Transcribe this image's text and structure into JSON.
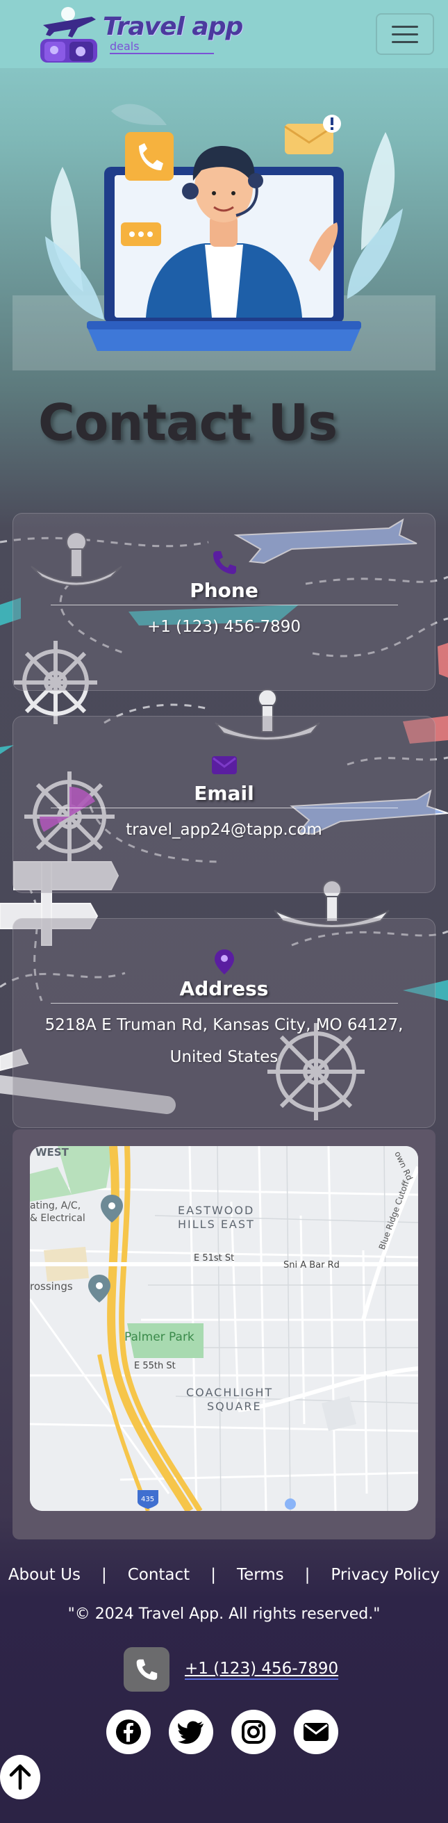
{
  "navbar": {
    "brand_title": "Travel app",
    "brand_sub": "deals",
    "toggler_icon": "hamburger-menu-icon"
  },
  "hero": {
    "title": "Contact Us",
    "illustration": "customer-support-agent-laptop"
  },
  "cards": {
    "phone": {
      "title": "Phone",
      "text": "+1 (123) 456-7890",
      "icon": "phone-icon",
      "icon_color": "#5a1ea0"
    },
    "email": {
      "title": "Email",
      "text": "travel_app24@tapp.com",
      "icon": "envelope-icon",
      "icon_color": "#5a1ea0"
    },
    "address": {
      "title": "Address",
      "text": "5218A E Truman Rd, Kansas City, MO 64127, United States",
      "icon": "map-pin-icon"
    }
  },
  "map": {
    "labels": {
      "west": "WEST",
      "eastwood1": "EASTWOOD",
      "eastwood2": "HILLS EAST",
      "street1": "E 51st St",
      "street2": "Sni A Bar Rd",
      "ac1": "ating, A/C,",
      "ac2": "& Electrical",
      "crossings": "rossings",
      "park": "Palmer Park",
      "street3": "E 55th St",
      "coach1": "COACHLIGHT",
      "coach2": "SQUARE",
      "blueridge": "Blue Ridge Cutoff",
      "town": "own Rd",
      "hwy": "435"
    }
  },
  "footer": {
    "links": [
      "About Us",
      "Contact",
      "Terms",
      "Privacy Policy"
    ],
    "separator": "|",
    "copyright": "\"© 2024 Travel App. All rights reserved.\"",
    "phone": "+1 (123) 456-7890",
    "socials": [
      "facebook-icon",
      "twitter-icon",
      "instagram-icon",
      "envelope-icon"
    ]
  },
  "colors": {
    "navbar_bg": "#8ed1cf",
    "brand": "#4b3a9e",
    "accent_purple": "#5a1ea0",
    "footer_bg": "#2c2345"
  }
}
